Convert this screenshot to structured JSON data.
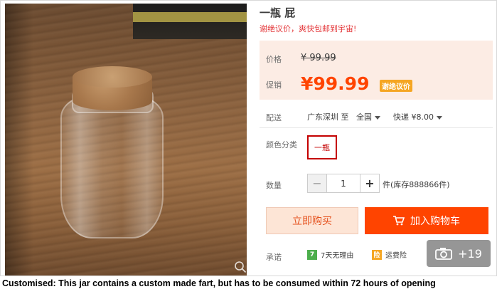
{
  "product": {
    "title": "一瓶 屁",
    "subtitle": "谢绝议价，爽快包邮到宇宙!"
  },
  "price": {
    "label": "价格",
    "original": "¥ 99.99",
    "promo_label": "促销",
    "promo": "¥99.99",
    "badge": "谢绝议价"
  },
  "shipping": {
    "label": "配送",
    "origin": "广东深圳 至",
    "destination": "全国",
    "method": "快递 ¥8.00"
  },
  "color": {
    "label": "颜色分类",
    "selected": "一瓶"
  },
  "quantity": {
    "label": "数量",
    "minus": "−",
    "value": "1",
    "plus": "+",
    "stock": "件(库存888866件)"
  },
  "actions": {
    "buy_now": "立即购买",
    "add_to_cart": "加入购物车"
  },
  "promise": {
    "label": "承诺",
    "items": [
      {
        "icon_text": "7",
        "text": "7天无理由"
      },
      {
        "icon_text": "险",
        "text": "运费险"
      }
    ]
  },
  "gallery": {
    "more_count": "+19"
  },
  "caption": "Customised: This jar contains a custom made fart, but has to be consumed within 72 hours of opening",
  "colors": {
    "accent": "#ff4400",
    "price_bg": "#fcece4",
    "selected_border": "#c40000"
  }
}
